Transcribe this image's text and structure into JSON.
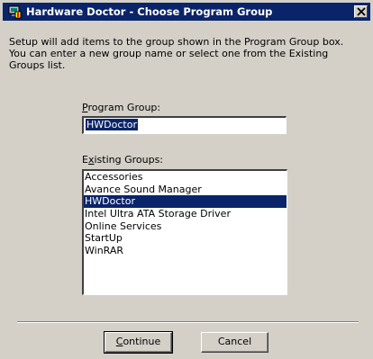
{
  "window": {
    "title": "Hardware Doctor - Choose Program Group"
  },
  "intro": "Setup will add items to the group shown in the Program Group box.\nYou can enter a new group name or select one from the Existing\nGroups list.",
  "program_group": {
    "label_prefix": "",
    "label_accel": "P",
    "label_rest": "rogram Group:",
    "value": "HWDoctor"
  },
  "existing_groups": {
    "label_prefix": "E",
    "label_accel": "x",
    "label_rest": "isting Groups:",
    "items": [
      "Accessories",
      "Avance Sound Manager",
      "HWDoctor",
      "Intel Ultra ATA Storage Driver",
      "Online Services",
      "StartUp",
      "WinRAR"
    ],
    "selected": "HWDoctor"
  },
  "buttons": {
    "continue_accel": "C",
    "continue_rest": "ontinue",
    "cancel": "Cancel"
  },
  "icons": {
    "app": "hardware-doctor-icon",
    "close": "close-icon"
  },
  "colors": {
    "titlebar": "#0a246a",
    "face": "#d4d0c8",
    "selection": "#0a246a"
  }
}
